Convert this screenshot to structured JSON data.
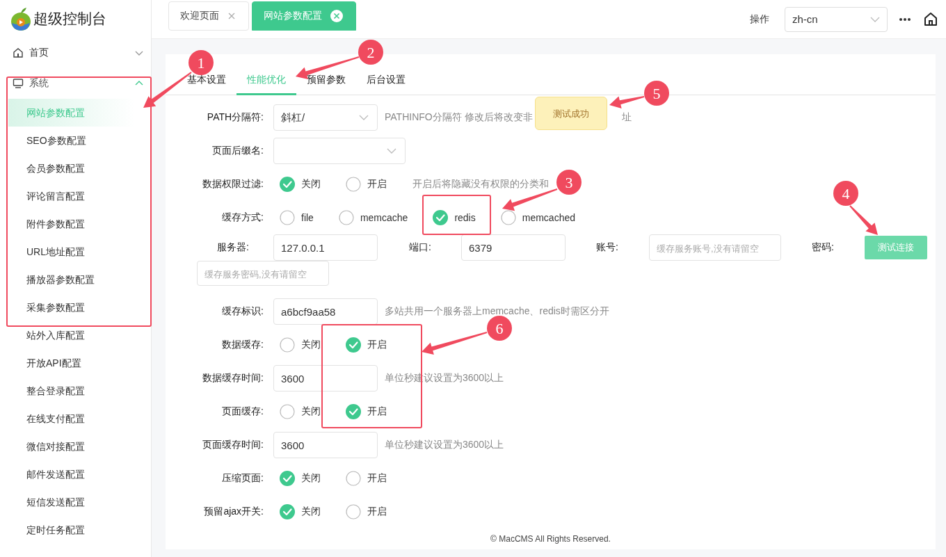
{
  "brand": {
    "title": "超级控制台"
  },
  "sidebar": {
    "items": [
      {
        "label": "首页",
        "expanded": false
      },
      {
        "label": "系统",
        "expanded": true,
        "children": [
          {
            "label": "网站参数配置",
            "selected": true
          },
          {
            "label": "SEO参数配置",
            "selected": false
          },
          {
            "label": "会员参数配置",
            "selected": false
          },
          {
            "label": "评论留言配置",
            "selected": false
          },
          {
            "label": "附件参数配置",
            "selected": false
          },
          {
            "label": "URL地址配置",
            "selected": false
          },
          {
            "label": "播放器参数配置",
            "selected": false
          },
          {
            "label": "采集参数配置",
            "selected": false
          },
          {
            "label": "站外入库配置",
            "selected": false
          },
          {
            "label": "开放API配置",
            "selected": false
          },
          {
            "label": "整合登录配置",
            "selected": false
          },
          {
            "label": "在线支付配置",
            "selected": false
          },
          {
            "label": "微信对接配置",
            "selected": false
          },
          {
            "label": "邮件发送配置",
            "selected": false
          },
          {
            "label": "短信发送配置",
            "selected": false
          },
          {
            "label": "定时任务配置",
            "selected": false
          }
        ]
      }
    ]
  },
  "tabs": [
    {
      "label": "欢迎页面",
      "selected": false
    },
    {
      "label": "网站参数配置",
      "selected": true
    }
  ],
  "header": {
    "action_label": "操作",
    "language": "zh-cn"
  },
  "subtabs": [
    {
      "label": "基本设置",
      "selected": false
    },
    {
      "label": "性能优化",
      "selected": true
    },
    {
      "label": "预留参数",
      "selected": false
    },
    {
      "label": "后台设置",
      "selected": false
    }
  ],
  "form": {
    "rows": [
      {
        "kind": "select",
        "label": "PATH分隔符:",
        "value": "斜杠/",
        "hint": "PATHINFO分隔符 修改后将改变非",
        "hint_tail": "址"
      },
      {
        "kind": "select",
        "label": "页面后缀名:"
      },
      {
        "kind": "radio",
        "label": "数据权限过滤:",
        "options": [
          {
            "label": "关闭",
            "selected": true
          },
          {
            "label": "开启",
            "selected": false
          }
        ],
        "hint": "开启后将隐藏没有权限的分类和"
      },
      {
        "kind": "radio",
        "label": "缓存方式:",
        "options": [
          {
            "label": "file",
            "selected": false
          },
          {
            "label": "memcache",
            "selected": false
          },
          {
            "label": "redis",
            "selected": true
          },
          {
            "label": "memcached",
            "selected": false
          }
        ]
      },
      {
        "kind": "fields",
        "fields": [
          {
            "label": "服务器:",
            "value": "127.0.0.1"
          },
          {
            "label": "端口:",
            "value": "6379"
          },
          {
            "label": "账号:",
            "placeholder": "缓存服务账号,没有请留空"
          },
          {
            "label": "密码:",
            "placeholder": "缓存服务密码,没有请留空"
          }
        ],
        "button": {
          "label": "测试连接"
        }
      },
      {
        "kind": "input",
        "label": "缓存标识:",
        "value": "a6bcf9aa58",
        "hint": "多站共用一个服务器上memcache、redis时需区分开"
      },
      {
        "kind": "radio",
        "label": "数据缓存:",
        "options": [
          {
            "label": "关闭",
            "selected": false
          },
          {
            "label": "开启",
            "selected": true
          }
        ]
      },
      {
        "kind": "input",
        "label": "数据缓存时间:",
        "value": "3600",
        "hint": "单位秒建议设置为3600以上"
      },
      {
        "kind": "radio",
        "label": "页面缓存:",
        "options": [
          {
            "label": "关闭",
            "selected": false
          },
          {
            "label": "开启",
            "selected": true
          }
        ]
      },
      {
        "kind": "input",
        "label": "页面缓存时间:",
        "value": "3600",
        "hint": "单位秒建议设置为3600以上"
      },
      {
        "kind": "radio",
        "label": "压缩页面:",
        "options": [
          {
            "label": "关闭",
            "selected": true
          },
          {
            "label": "开启",
            "selected": false
          }
        ]
      },
      {
        "kind": "radio",
        "label": "预留ajax开关:",
        "options": [
          {
            "label": "关闭",
            "selected": true
          },
          {
            "label": "开启",
            "selected": false
          }
        ]
      }
    ]
  },
  "toast": {
    "text": "测试成功"
  },
  "footer": "© MacCMS All Rights Reserved.",
  "annotations": [
    {
      "number": "1"
    },
    {
      "number": "2"
    },
    {
      "number": "3"
    },
    {
      "number": "4"
    },
    {
      "number": "5"
    },
    {
      "number": "6"
    }
  ]
}
